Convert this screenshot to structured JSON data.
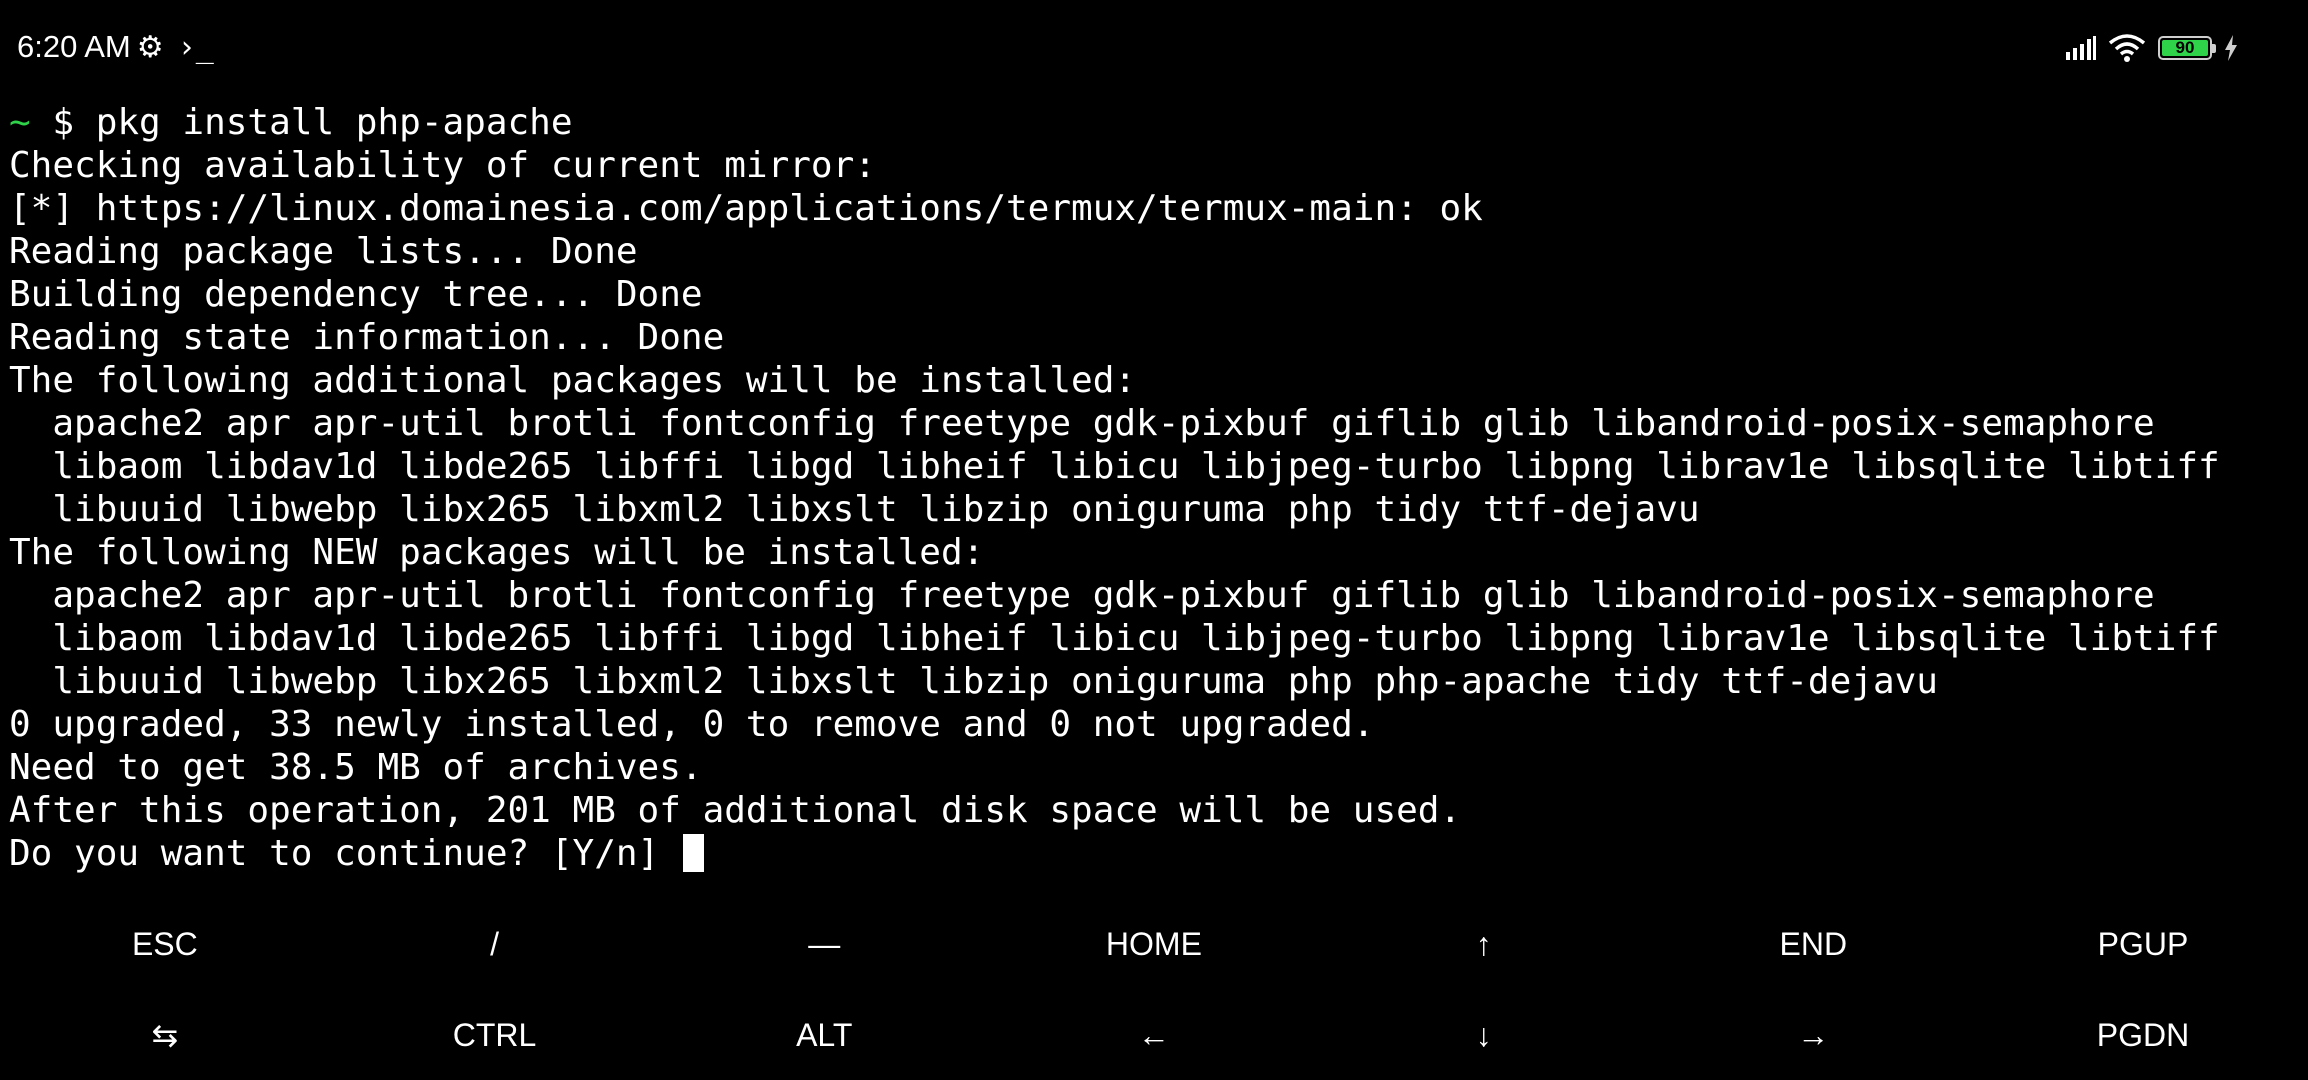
{
  "status_bar": {
    "time": "6:20 AM",
    "settings_glyph": "⚙",
    "terminal_glyph": "›_",
    "battery_level": "90",
    "icons": [
      "signal-icon",
      "wifi-icon",
      "battery-icon",
      "charging-icon"
    ]
  },
  "terminal": {
    "prompt_symbol": "~",
    "prompt_command": " $ pkg install php-apache",
    "output_lines": [
      "Checking availability of current mirror:",
      "[*] https://linux.domainesia.com/applications/termux/termux-main: ok",
      "Reading package lists... Done",
      "Building dependency tree... Done",
      "Reading state information... Done",
      "The following additional packages will be installed:",
      "  apache2 apr apr-util brotli fontconfig freetype gdk-pixbuf giflib glib libandroid-posix-semaphore",
      "  libaom libdav1d libde265 libffi libgd libheif libicu libjpeg-turbo libpng librav1e libsqlite libtiff",
      "  libuuid libwebp libx265 libxml2 libxslt libzip oniguruma php tidy ttf-dejavu",
      "The following NEW packages will be installed:",
      "  apache2 apr apr-util brotli fontconfig freetype gdk-pixbuf giflib glib libandroid-posix-semaphore",
      "  libaom libdav1d libde265 libffi libgd libheif libicu libjpeg-turbo libpng librav1e libsqlite libtiff",
      "  libuuid libwebp libx265 libxml2 libxslt libzip oniguruma php php-apache tidy ttf-dejavu",
      "0 upgraded, 33 newly installed, 0 to remove and 0 not upgraded.",
      "Need to get 38.5 MB of archives.",
      "After this operation, 201 MB of additional disk space will be used."
    ],
    "input_prompt": "Do you want to continue? [Y/n] "
  },
  "extra_keys": {
    "row1": [
      "ESC",
      "/",
      "—",
      "HOME",
      "↑",
      "END",
      "PGUP"
    ],
    "row2": [
      "⇆",
      "CTRL",
      "ALT",
      "←",
      "↓",
      "→",
      "PGDN"
    ]
  },
  "colors": {
    "background": "#000000",
    "text": "#ffffff",
    "prompt_accent": "#2fd34a",
    "battery_fill": "#2fd34a"
  }
}
